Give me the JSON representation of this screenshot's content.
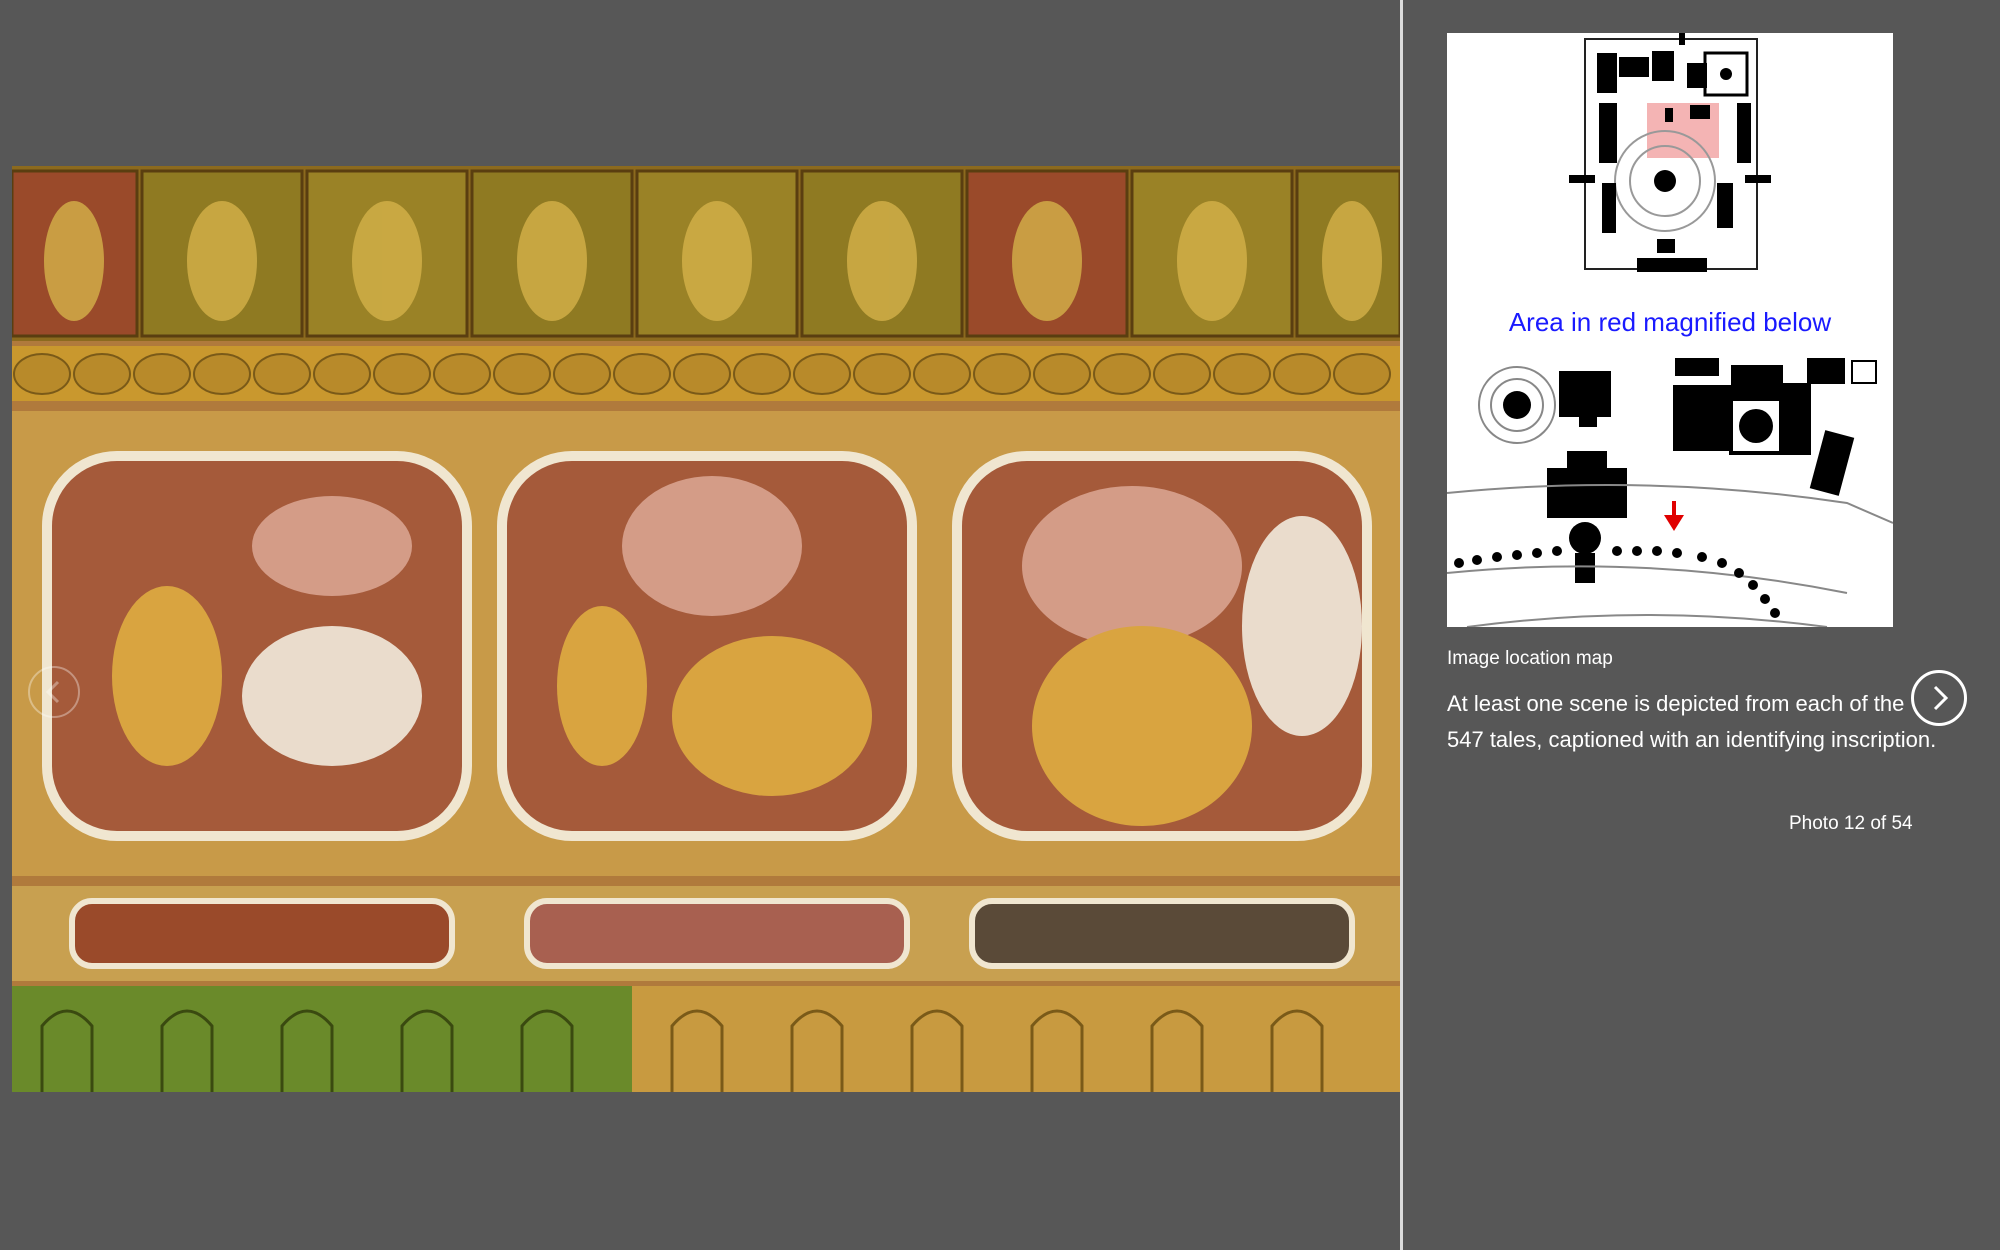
{
  "viewer": {
    "photo_alt": "Glazed terracotta tiles depicting Jataka scenes with inscriptions"
  },
  "sidebar": {
    "map": {
      "heading": "Area in red magnified below",
      "caption": "Image location map"
    },
    "description": "At least one scene is depicted from each of the 547 tales, captioned with an identifying inscription.",
    "counter": "Photo 12 of 54"
  },
  "icons": {
    "prev": "chevron-left-icon",
    "next": "chevron-right-icon"
  },
  "colors": {
    "background": "#575757",
    "divider": "#dcdcdc",
    "map_heading": "#1a1aff",
    "highlight": "#f4b4b4",
    "arrow": "#e00000"
  }
}
